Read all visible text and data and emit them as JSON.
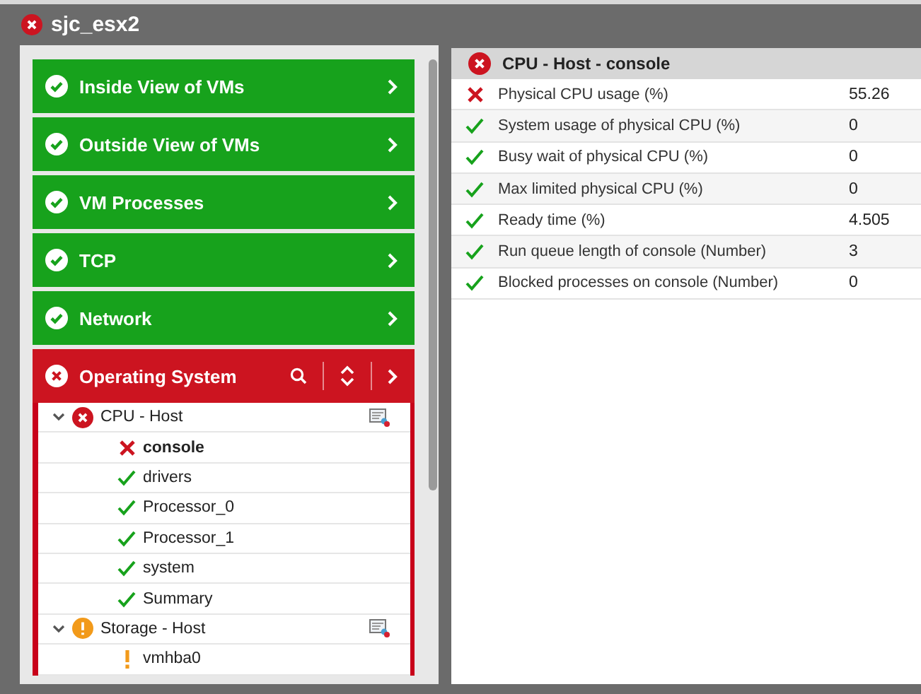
{
  "window": {
    "title": "sjc_esx2",
    "kind": "error"
  },
  "sections": [
    {
      "label": "Inside View of VMs",
      "kind": "ok",
      "expanded": false
    },
    {
      "label": "Outside View of VMs",
      "kind": "ok",
      "expanded": false
    },
    {
      "label": "VM Processes",
      "kind": "ok",
      "expanded": false
    },
    {
      "label": "TCP",
      "kind": "ok",
      "expanded": false
    },
    {
      "label": "Network",
      "kind": "ok",
      "expanded": false
    },
    {
      "label": "Operating System",
      "kind": "error",
      "expanded": true,
      "tree": [
        {
          "label": "CPU - Host",
          "kind": "error",
          "expanded": true,
          "children": [
            {
              "label": "console",
              "kind": "error",
              "selected": true
            },
            {
              "label": "drivers",
              "kind": "ok",
              "selected": false
            },
            {
              "label": "Processor_0",
              "kind": "ok",
              "selected": false
            },
            {
              "label": "Processor_1",
              "kind": "ok",
              "selected": false
            },
            {
              "label": "system",
              "kind": "ok",
              "selected": false
            },
            {
              "label": "Summary",
              "kind": "ok",
              "selected": false
            }
          ]
        },
        {
          "label": "Storage - Host",
          "kind": "warning",
          "expanded": true,
          "children": [
            {
              "label": "vmhba0",
              "kind": "warning",
              "selected": false
            }
          ]
        }
      ]
    }
  ],
  "detail": {
    "title": "CPU - Host - console",
    "kind": "error",
    "rows": [
      {
        "name": "Physical CPU usage (%)",
        "kind": "error",
        "value": "55.26"
      },
      {
        "name": "System usage of physical CPU (%)",
        "kind": "ok",
        "value": "0"
      },
      {
        "name": "Busy wait of physical CPU (%)",
        "kind": "ok",
        "value": "0"
      },
      {
        "name": "Max limited physical CPU (%)",
        "kind": "ok",
        "value": "0"
      },
      {
        "name": "Ready time (%)",
        "kind": "ok",
        "value": "4.505"
      },
      {
        "name": "Run queue length of console (Number)",
        "kind": "ok",
        "value": "3"
      },
      {
        "name": "Blocked processes on console (Number)",
        "kind": "ok",
        "value": "0"
      }
    ]
  }
}
